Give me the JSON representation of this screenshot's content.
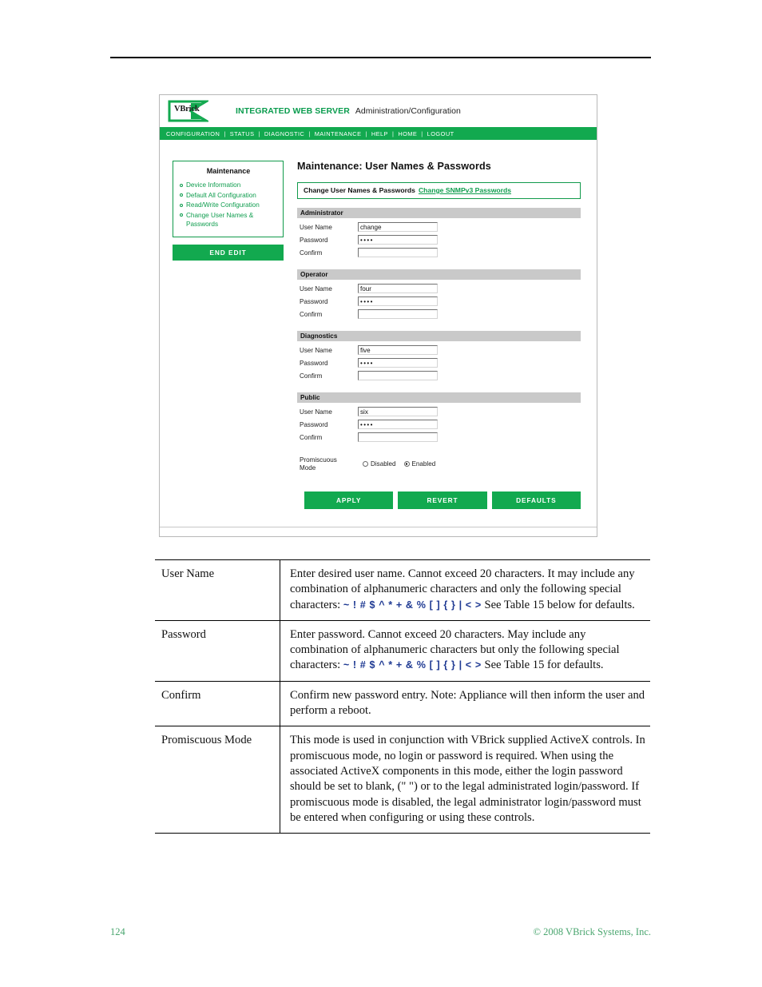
{
  "page": {
    "number": "124",
    "copyright": "© 2008 VBrick Systems, Inc."
  },
  "app": {
    "logo_text": "VBrick",
    "header_title": "INTEGRATED WEB SERVER",
    "header_subtitle": "Administration/Configuration",
    "nav": [
      "CONFIGURATION",
      "STATUS",
      "DIAGNOSTIC",
      "MAINTENANCE",
      "HELP",
      "HOME",
      "LOGOUT"
    ],
    "sidebar": {
      "title": "Maintenance",
      "items": [
        "Device Information",
        "Default All Configuration",
        "Read/Write Configuration",
        "Change User Names & Passwords"
      ],
      "end_edit_label": "END EDIT"
    },
    "panel": {
      "title": "Maintenance: User Names & Passwords",
      "subnav_label": "Change User Names & Passwords",
      "subnav_link": "Change SNMPv3 Passwords"
    },
    "sections": [
      {
        "heading": "Administrator",
        "fields": [
          {
            "label": "User Name",
            "value": "change",
            "type": "text"
          },
          {
            "label": "Password",
            "value": "••••",
            "type": "password"
          },
          {
            "label": "Confirm",
            "value": "",
            "type": "password"
          }
        ]
      },
      {
        "heading": "Operator",
        "fields": [
          {
            "label": "User Name",
            "value": "four",
            "type": "text"
          },
          {
            "label": "Password",
            "value": "••••",
            "type": "password"
          },
          {
            "label": "Confirm",
            "value": "",
            "type": "password"
          }
        ]
      },
      {
        "heading": "Diagnostics",
        "fields": [
          {
            "label": "User Name",
            "value": "five",
            "type": "text"
          },
          {
            "label": "Password",
            "value": "••••",
            "type": "password"
          },
          {
            "label": "Confirm",
            "value": "",
            "type": "password"
          }
        ]
      },
      {
        "heading": "Public",
        "fields": [
          {
            "label": "User Name",
            "value": "six",
            "type": "text"
          },
          {
            "label": "Password",
            "value": "••••",
            "type": "password"
          },
          {
            "label": "Confirm",
            "value": "",
            "type": "password"
          }
        ]
      }
    ],
    "promiscuous": {
      "label_line1": "Promiscuous",
      "label_line2": "Mode",
      "options": [
        {
          "label": "Disabled",
          "selected": false
        },
        {
          "label": "Enabled",
          "selected": true
        }
      ]
    },
    "buttons": [
      "APPLY",
      "REVERT",
      "DEFAULTS"
    ],
    "colors": {
      "brand_green": "#12a94f",
      "link_green": "#0f9d4e",
      "section_gray": "#c9c9c9"
    }
  },
  "description_table": {
    "rows": [
      {
        "term": "User Name",
        "parts": [
          {
            "text": "Enter desired user name. Cannot exceed 20 characters. It may include any combination of alphanumeric characters and only the following special characters: ",
            "style": "normal"
          },
          {
            "text": "~ ! # $ ^ * + & % [ ] { } | < >",
            "style": "special"
          },
          {
            "text": " See Table 15 below for defaults.",
            "style": "normal"
          }
        ]
      },
      {
        "term": "Password",
        "parts": [
          {
            "text": "Enter password. Cannot exceed 20 characters. May include any combination of alphanumeric characters but only the following special characters: ",
            "style": "normal"
          },
          {
            "text": "~ ! # $ ^ * + & % [ ] { } | < >",
            "style": "special"
          },
          {
            "text": " See Table 15 for defaults.",
            "style": "normal"
          }
        ]
      },
      {
        "term": "Confirm",
        "parts": [
          {
            "text": "Confirm new password entry. Note: Appliance will then inform the user and perform a reboot.",
            "style": "normal"
          }
        ]
      },
      {
        "term": "Promiscuous Mode",
        "parts": [
          {
            "text": "This mode is used in conjunction with VBrick supplied ActiveX controls. In promiscuous mode, no login or password is required. When using the associated ActiveX components in this mode, either the login password should be set to blank, (\" \") or to the legal administrated login/password. If promiscuous mode is disabled, the legal administrator login/password must be entered when configuring or using these controls.",
            "style": "normal"
          }
        ]
      }
    ]
  }
}
